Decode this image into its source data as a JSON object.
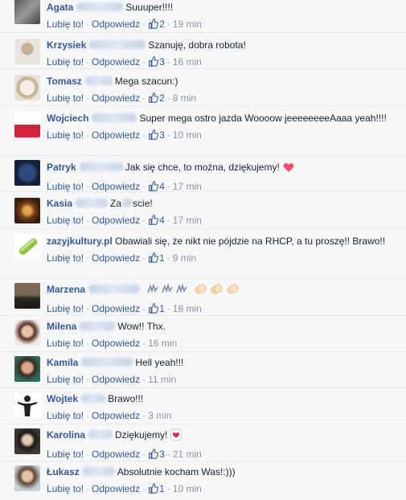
{
  "actions": {
    "like": "Lubię to!",
    "reply": "Odpowiedz",
    "dot": "·"
  },
  "comments": [
    {
      "name": "Agata",
      "text": "Suuuper!!!!",
      "likes": "2",
      "time": "19 min"
    },
    {
      "name": "Krzysiek",
      "text": "Szanuję, dobra robota!",
      "likes": "3",
      "time": "16 min"
    },
    {
      "name": "Tomasz",
      "text": "Mega szacun:)",
      "likes": "2",
      "time": "8 min"
    },
    {
      "name": "Wojciech",
      "text": "Super mega ostro jazda Woooow jeeeeeeeeAaaa yeah!!!!",
      "likes": "3",
      "time": "10 min"
    },
    {
      "name": "Patryk",
      "text": "Jak się chce, to można, dziękujemy!",
      "likes": "4",
      "time": "17 min"
    },
    {
      "name": "Kasia",
      "text_a": "Za",
      "text_b": "scie!",
      "likes": "4",
      "time": "17 min"
    },
    {
      "name": "zazyjkultury.pl",
      "text": "Obawiali się, że nikt nie pójdzie na RHCP, a tu proszę!! Brawo!!",
      "likes": "1",
      "time": "9 min"
    },
    {
      "name": "Marzena",
      "likes": "1",
      "time": "18 min"
    },
    {
      "name": "Milena",
      "text": "Wow!! Thx.",
      "likes": "",
      "time": "16 min"
    },
    {
      "name": "Kamila",
      "text": "Hell yeah!!!",
      "likes": "",
      "time": "11 min"
    },
    {
      "name": "Wojtek",
      "text": "Brawo!!!",
      "likes": "",
      "time": "3 min"
    },
    {
      "name": "Karolina",
      "text": "Dziękujemy!",
      "likes": "3",
      "time": "21 min"
    },
    {
      "name": "Łukasz",
      "text": "Absolutnie kocham Was!:)))",
      "likes": "1",
      "time": "10 min"
    }
  ],
  "colors": {
    "link": "#365899",
    "meta": "#90949c",
    "text": "#1d2129",
    "background": "#f6f7f9",
    "heart": "#f25268"
  }
}
